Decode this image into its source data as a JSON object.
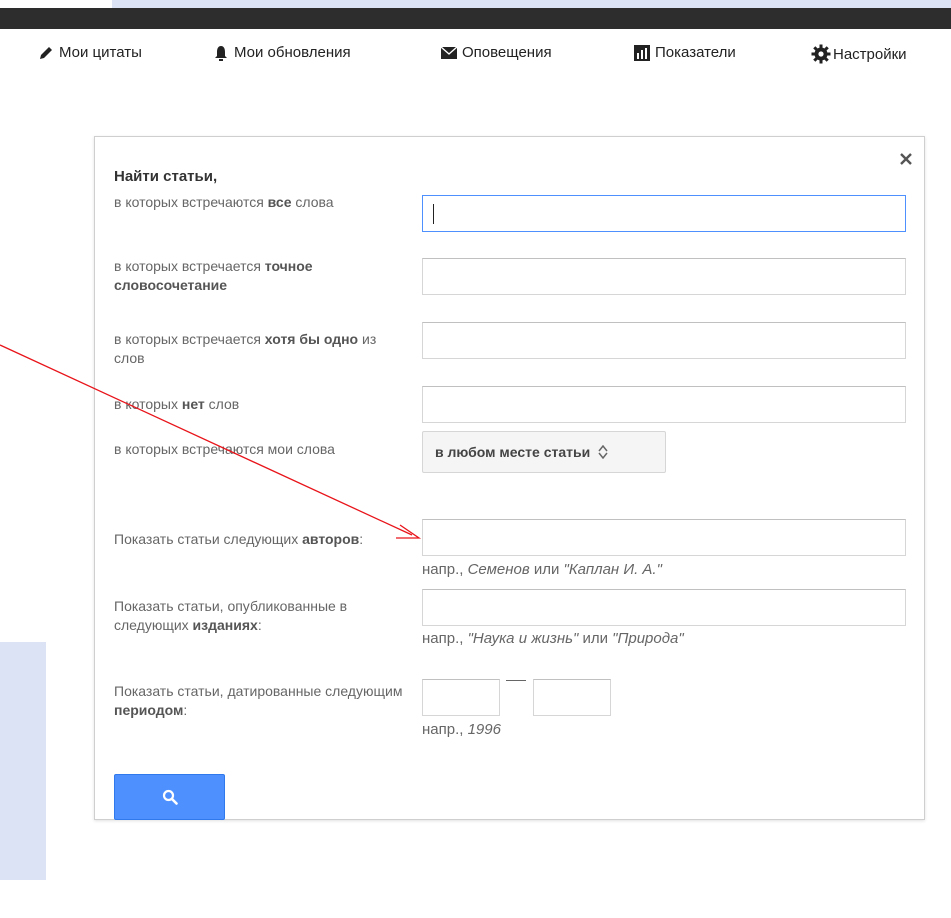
{
  "nav": {
    "items": [
      {
        "label": "Мои цитаты",
        "icon": "pencil-icon"
      },
      {
        "label": "Мои обновления",
        "icon": "bell-icon"
      },
      {
        "label": "Оповещения",
        "icon": "envelope-icon"
      },
      {
        "label": "Показатели",
        "icon": "bar-chart-icon"
      },
      {
        "label": "Настройки",
        "icon": "gear-icon"
      }
    ]
  },
  "dialog": {
    "title": "Найти статьи,",
    "rows": {
      "all_words": {
        "prefix": "в которых встречаются ",
        "bold": "все",
        "suffix": " слова",
        "value": ""
      },
      "exact_phrase": {
        "prefix": "в которых встречается ",
        "bold": "точное словосочетание",
        "suffix": "",
        "value": ""
      },
      "any_words": {
        "prefix": "в которых встречается ",
        "bold": "хотя бы одно",
        "suffix": " из слов",
        "value": ""
      },
      "none_words": {
        "prefix": "в которых ",
        "bold": "нет",
        "suffix": " слов",
        "value": ""
      },
      "where": {
        "label": "в которых встречаются мои слова",
        "selected": "в любом месте статьи"
      },
      "authors": {
        "prefix": "Показать статьи следующих ",
        "bold": "авторов",
        "suffix": ":",
        "value": "",
        "hint_prefix": "напр., ",
        "hint_a": "Семенов",
        "hint_mid": " или ",
        "hint_b": "\"Каплан И. А.\""
      },
      "publication": {
        "prefix": "Показать статьи, опубликованные в следующих ",
        "bold": "изданиях",
        "suffix": ":",
        "value": "",
        "hint_prefix": "напр., ",
        "hint_a": "\"Наука и жизнь\"",
        "hint_mid": " или ",
        "hint_b": "\"Природа\""
      },
      "period": {
        "prefix": "Показать статьи, датированные следующим ",
        "bold": "периодом",
        "suffix": ":",
        "from": "",
        "to": "",
        "hint_prefix": "напр., ",
        "hint_a": "1996"
      }
    }
  },
  "colors": {
    "accent": "#4d90fe",
    "annotation_arrow": "#e8141a",
    "topbar": "#2d2d2d",
    "slide_bg": "#dbe3f4"
  }
}
